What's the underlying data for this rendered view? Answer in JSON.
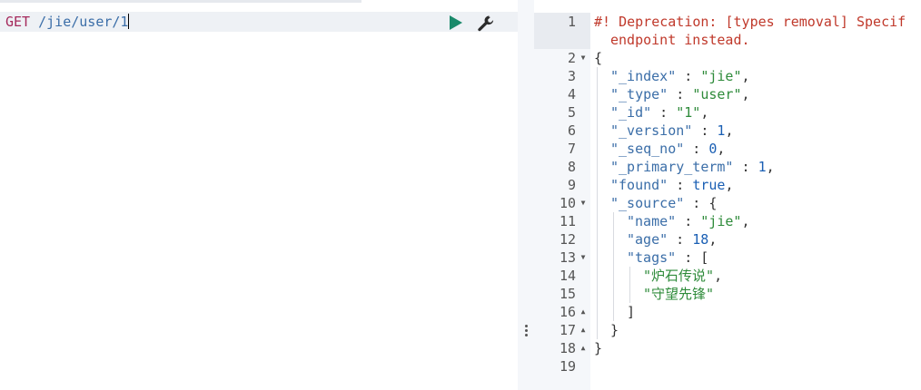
{
  "request": {
    "method": "GET",
    "path": "/jie/user/1"
  },
  "toolbar": {
    "run_icon": "play-icon",
    "settings_icon": "wrench-icon"
  },
  "response": {
    "line_numbers": [
      "1",
      "2",
      "3",
      "4",
      "5",
      "6",
      "7",
      "8",
      "9",
      "10",
      "11",
      "12",
      "13",
      "14",
      "15",
      "16",
      "17",
      "18",
      "19"
    ],
    "comment_line1": "#! Deprecation: [types removal] Specif",
    "comment_line2": "endpoint instead.",
    "open_brace": "{",
    "index_key": "\"_index\"",
    "index_val": "\"jie\"",
    "type_key": "\"_type\"",
    "type_val": "\"user\"",
    "id_key": "\"_id\"",
    "id_val": "\"1\"",
    "version_key": "\"_version\"",
    "version_val": "1",
    "seq_key": "\"_seq_no\"",
    "seq_val": "0",
    "term_key": "\"_primary_term\"",
    "term_val": "1",
    "found_key": "\"found\"",
    "found_val": "true",
    "source_key": "\"_source\"",
    "name_key": "\"name\"",
    "name_val": "\"jie\"",
    "age_key": "\"age\"",
    "age_val": "18",
    "tags_key": "\"tags\"",
    "tag1": "\"炉石传说\"",
    "tag2": "\"守望先锋\"",
    "close_bracket": "]",
    "close_inner": "}",
    "close_outer": "}"
  },
  "colors": {
    "comment": "#c0392b",
    "key": "#3b6ea8",
    "string": "#2e8b3a",
    "number": "#1a5fb4",
    "run": "#1a8a6b"
  }
}
